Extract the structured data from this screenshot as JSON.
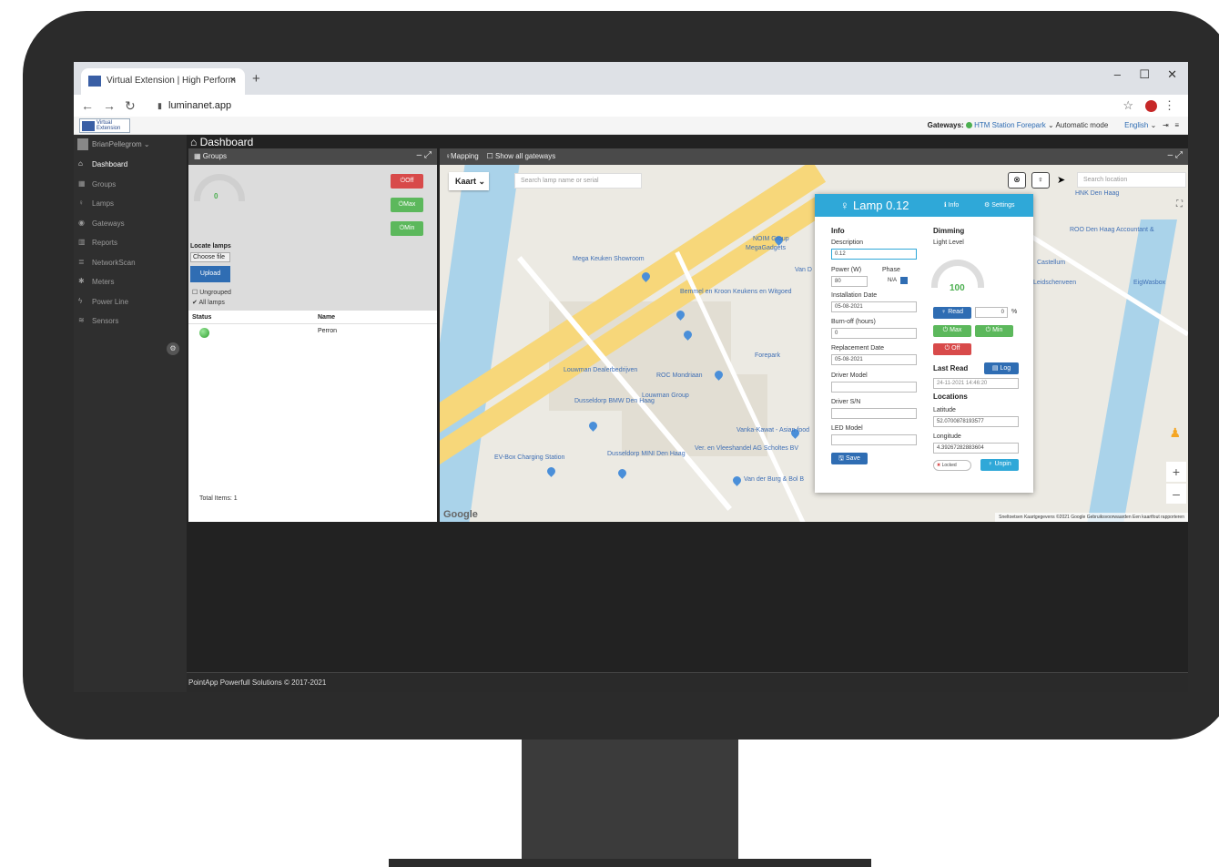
{
  "browser": {
    "tab_title": "Virtual Extension | High Perform",
    "tab_close": "×",
    "new_tab": "+",
    "url": "luminanet.app",
    "window_controls": [
      "–",
      "☐",
      "✕"
    ]
  },
  "header": {
    "logo_line1": "Virtual",
    "logo_line2": "Extension",
    "gateways_label": "Gateways:",
    "gateway_name": "HTM Station Forepark",
    "mode": "Automatic mode",
    "language": "English"
  },
  "sidebar": {
    "user": "BrianPellegrom",
    "items": [
      {
        "label": "Dashboard",
        "icon": "home-icon",
        "glyph": "⌂"
      },
      {
        "label": "Groups",
        "icon": "groups-icon",
        "glyph": "▦"
      },
      {
        "label": "Lamps",
        "icon": "lamp-icon",
        "glyph": "♀"
      },
      {
        "label": "Gateways",
        "icon": "gateway-icon",
        "glyph": "◉"
      },
      {
        "label": "Reports",
        "icon": "chart-icon",
        "glyph": "▥"
      },
      {
        "label": "NetworkScan",
        "icon": "network-icon",
        "glyph": "≣"
      },
      {
        "label": "Meters",
        "icon": "meters-icon",
        "glyph": "✱"
      },
      {
        "label": "Power Line",
        "icon": "power-icon",
        "glyph": "ϟ"
      },
      {
        "label": "Sensors",
        "icon": "sensor-icon",
        "glyph": "≋"
      }
    ]
  },
  "page": {
    "title": "Dashboard"
  },
  "groups_panel": {
    "title": "Groups",
    "gauge_value": "0",
    "off": "Off",
    "max": "Max",
    "min": "Min",
    "locate_lamps": "Locate lamps",
    "choose_file": "Choose file",
    "upload": "Upload",
    "ungrouped": "Ungrouped",
    "all_lamps": "All lamps",
    "col_status": "Status",
    "col_name": "Name",
    "rows": [
      {
        "name": "Perron"
      }
    ],
    "total": "Total Items: 1"
  },
  "mapping_panel": {
    "title": "Mapping",
    "show_all": "Show all gateways",
    "map_type": "Kaart",
    "lamp_search_placeholder": "Search lamp name or serial",
    "location_search_placeholder": "Search location",
    "attribution": "Sneltoetsen   Kaartgegevens ©2021 Google   Gebruiksvoorwaarden   Een kaartfout rapporteren",
    "google": "Google",
    "pois": [
      "Mega Keuken Showroom",
      "Bemmel en Kroon Keukens en Witgoed",
      "NOIM Group",
      "MegaGadgets",
      "Van D",
      "Forepark",
      "Louwman Dealerbedrijven",
      "ROC Mondriaan",
      "Louwman Group",
      "Dusseldorp BMW Den Haag",
      "EV-Box Charging Station",
      "Dusseldorp MINI Den Haag",
      "Vanka-Kawat - Asian food",
      "Ver. en Vleeshandel AG Scholtes BV",
      "Van der Burg & Bol B",
      "HNK Den Haag",
      "ROO Den Haag Accountant &",
      "Castellum",
      "Leidschenveen",
      "EigWasbox"
    ]
  },
  "lamp_popup": {
    "title": "Lamp 0.12",
    "tab_info": "Info",
    "tab_settings": "Settings",
    "info_heading": "Info",
    "description_label": "Description",
    "description": "0.12",
    "power_label": "Power (W)",
    "power": "80",
    "phase_label": "Phase",
    "phase": "N/A",
    "install_label": "Installation Date",
    "install": "05-08-2021",
    "burnoff_label": "Burn-off (hours)",
    "burnoff": "0",
    "replace_label": "Replacement Date",
    "replace": "05-08-2021",
    "driver_model_label": "Driver Model",
    "driver_sn_label": "Driver S/N",
    "led_model_label": "LED Model",
    "save": "Save",
    "dimming_heading": "Dimming",
    "light_level_label": "Light Level",
    "light_level": "100",
    "read": "Read",
    "read_pct": "0",
    "pct": "%",
    "max": "Max",
    "min": "Min",
    "off": "Off",
    "last_read_heading": "Last Read",
    "log": "Log",
    "last_read": "24-11-2021 14:46:20",
    "locations_heading": "Locations",
    "latitude_label": "Latitude",
    "latitude": "52.0700878193577",
    "longitude_label": "Longitude",
    "longitude": "4.39267282883604",
    "locked": "Locked",
    "unpin": "Unpin"
  },
  "footer": {
    "text": "PointApp Powerfull Solutions © 2017-2021"
  },
  "colors": {
    "accent": "#2fa8d8",
    "off": "#d84a4a",
    "on": "#5cb85c",
    "primary": "#2f6db3"
  }
}
